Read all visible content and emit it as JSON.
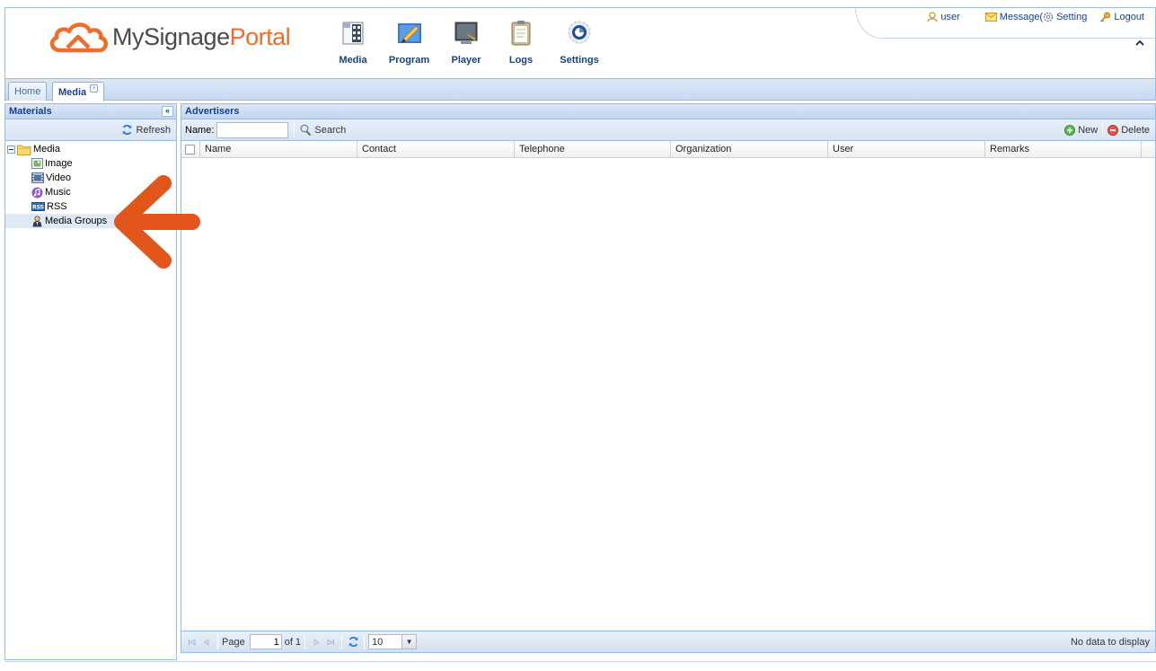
{
  "header": {
    "logo_part1": "MySignage",
    "logo_part2": "Portal",
    "nav": [
      {
        "label": "Media",
        "icon": "media-icon"
      },
      {
        "label": "Program",
        "icon": "program-icon"
      },
      {
        "label": "Player",
        "icon": "player-icon"
      },
      {
        "label": "Logs",
        "icon": "logs-icon"
      },
      {
        "label": "Settings",
        "icon": "settings-icon"
      }
    ],
    "toplinks": {
      "user": "user",
      "message": "Message(",
      "setting": "Setting",
      "logout": "Logout"
    }
  },
  "tabs": [
    {
      "label": "Home",
      "active": false
    },
    {
      "label": "Media",
      "active": true,
      "close": "×"
    }
  ],
  "left_panel": {
    "title": "Materials",
    "collapse": "«",
    "refresh_label": "Refresh",
    "tree": {
      "root": "Media",
      "children": [
        "Image",
        "Video",
        "Music",
        "RSS",
        "Media Groups"
      ],
      "selected": "Media Groups"
    }
  },
  "right_panel": {
    "title": "Advertisers",
    "name_label": "Name:",
    "name_value": "",
    "search_label": "Search",
    "new_label": "New",
    "delete_label": "Delete",
    "columns": [
      "Name",
      "Contact",
      "Telephone",
      "Organization",
      "User",
      "Remarks"
    ],
    "rows": []
  },
  "pager": {
    "page_label": "Page",
    "page_value": "1",
    "of_label": "of 1",
    "page_size": "10",
    "status": "No data to display"
  },
  "colors": {
    "brand_orange": "#ef6c2d",
    "brand_gray": "#4a4a4a",
    "panel_border": "#99bbe8",
    "header_text": "#15428b",
    "annotation_arrow": "#e2561b"
  }
}
